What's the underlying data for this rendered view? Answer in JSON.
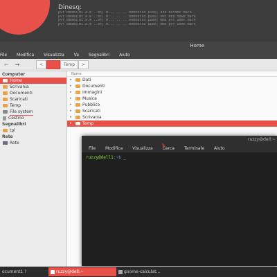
{
  "top_panel": {
    "title": "Dinesq:",
    "lines": [
      "pvt bmdmu|mi.a.m ..bt| m... .. .. mhmnbtsd pukb| and bvtmmt mark",
      "pvt bmdmu|mi.a.m ..bt| m... .. .. mhmnbtsd pukb|.bmt mnn mdwd  mark",
      "pvt bmdmu|mi.a.m ..bt| m... .. .. mhmnbtsd pukb| mmk pvt wdmt  mark",
      "pvt bmdmu|mi.a.m ..bt| m... .. .. mhmnbtsd pukb| mmk pvt wdmt  mark"
    ]
  },
  "file_manager": {
    "title": "Home",
    "menu": [
      "File",
      "Modifica",
      "Visualizza",
      "Va",
      "Segnalibri",
      "Aiuto"
    ],
    "toolbar": {
      "back": "←",
      "forward": "→",
      "path_left": "<",
      "path_right": ">"
    },
    "path": [
      "",
      "Temp"
    ],
    "sidebar": {
      "computer_header": "Computer",
      "computer_items": [
        {
          "label": "Home",
          "icon": "home-folder-icon",
          "active": true
        },
        {
          "label": "Scrivania",
          "icon": "folder-icon"
        },
        {
          "label": "Documenti",
          "icon": "folder-icon"
        },
        {
          "label": "Scaricati",
          "icon": "folder-icon"
        },
        {
          "label": "Temp",
          "icon": "folder-icon"
        },
        {
          "label": "File system",
          "icon": "drive-icon"
        },
        {
          "label": "Cestino",
          "icon": "trash-icon"
        }
      ],
      "bookmarks_header": "Segnalibri",
      "bookmarks": [
        {
          "label": "tpl",
          "icon": "folder-icon"
        }
      ],
      "network_header": "Rete",
      "network": [
        {
          "label": "Rete",
          "icon": "network-icon"
        }
      ]
    },
    "list_header": "Nome",
    "files": [
      {
        "name": "Dati"
      },
      {
        "name": "Documenti"
      },
      {
        "name": "Immagini"
      },
      {
        "name": "Musica"
      },
      {
        "name": "Pubblico"
      },
      {
        "name": "Scaricati"
      },
      {
        "name": "Scrivania"
      },
      {
        "name": "Temp",
        "selected": true
      }
    ]
  },
  "terminal": {
    "title": "ruzzy@dell:~",
    "menu": [
      "File",
      "Modifica",
      "Visualizza",
      "Cerca",
      "Terminale",
      "Aiuto"
    ],
    "prompt_user": "ruzzy@dell1",
    "prompt_path": ":~$",
    "cursor": "_"
  },
  "taskbar": {
    "tasks": [
      {
        "label": "ocument1 ?",
        "active": false
      },
      {
        "label": "ruzzy@dell:~",
        "active": true
      },
      {
        "label": "gnome-calculat...",
        "active": false
      }
    ]
  },
  "colors": {
    "accent": "#e8514a",
    "panel": "#444444",
    "terminal_bg": "#1f1f1f"
  }
}
